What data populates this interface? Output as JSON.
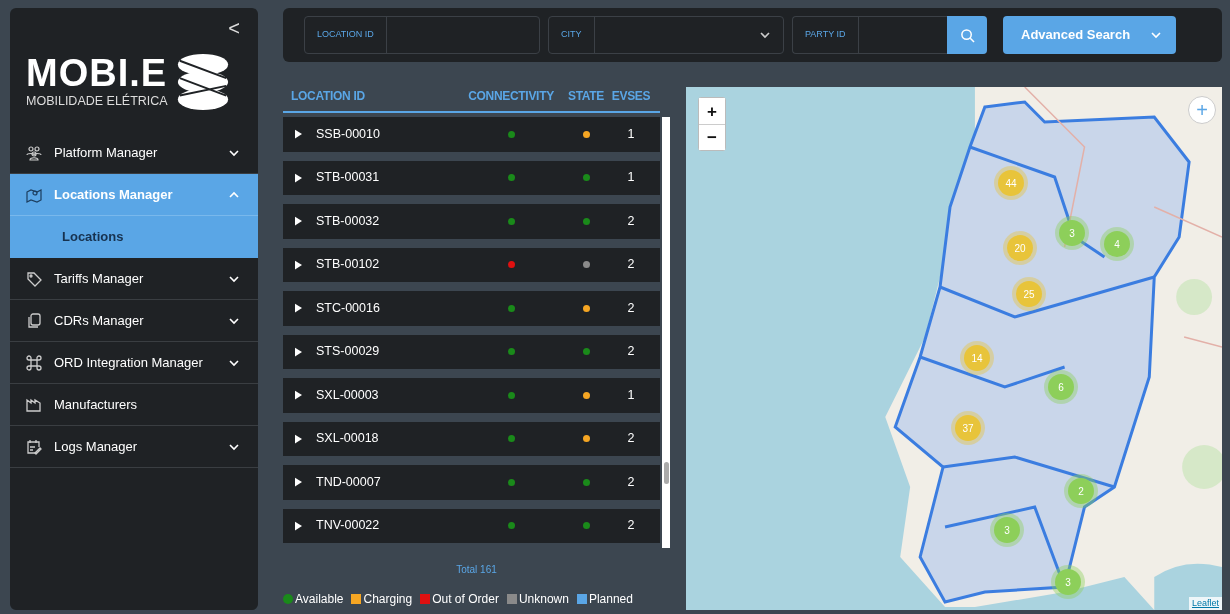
{
  "sidebar": {
    "collapse_glyph": "<",
    "logo": {
      "wordmark": "MOBI.E",
      "tagline": "MOBILIDADE ELÉTRICA"
    },
    "items": [
      {
        "label": "Platform Manager",
        "expanded": false,
        "selected": false
      },
      {
        "label": "Locations Manager",
        "expanded": true,
        "selected": true,
        "children": [
          {
            "label": "Locations",
            "selected": true
          }
        ]
      },
      {
        "label": "Tariffs Manager",
        "expanded": false,
        "selected": false
      },
      {
        "label": "CDRs Manager",
        "expanded": false,
        "selected": false
      },
      {
        "label": "ORD Integration Manager",
        "expanded": false,
        "selected": false
      },
      {
        "label": "Manufacturers",
        "selected": false
      },
      {
        "label": "Logs Manager",
        "expanded": false,
        "selected": false
      }
    ]
  },
  "search": {
    "fields": [
      {
        "label": "LOCATION ID",
        "kind": "text"
      },
      {
        "label": "CITY",
        "kind": "select"
      },
      {
        "label": "PARTY ID",
        "kind": "search"
      }
    ],
    "advanced_button": "Advanced Search"
  },
  "table": {
    "columns": [
      "LOCATION ID",
      "CONNECTIVITY",
      "STATE",
      "EVSES"
    ],
    "rows": [
      {
        "id": "SSB-00010",
        "connectivity": {
          "color": "#1a8a1a"
        },
        "state": {
          "color": "#f5a623"
        },
        "evses": "1"
      },
      {
        "id": "STB-00031",
        "connectivity": {
          "color": "#1a8a1a"
        },
        "state": {
          "color": "#1a8a1a"
        },
        "evses": "1"
      },
      {
        "id": "STB-00032",
        "connectivity": {
          "color": "#1a8a1a"
        },
        "state": {
          "color": "#1a8a1a"
        },
        "evses": "2"
      },
      {
        "id": "STB-00102",
        "connectivity": {
          "color": "#e01010"
        },
        "state": {
          "color": "#8a8a8a"
        },
        "evses": "2"
      },
      {
        "id": "STC-00016",
        "connectivity": {
          "color": "#1a8a1a"
        },
        "state": {
          "color": "#f5a623"
        },
        "evses": "2"
      },
      {
        "id": "STS-00029",
        "connectivity": {
          "color": "#1a8a1a"
        },
        "state": {
          "color": "#1a8a1a"
        },
        "evses": "2"
      },
      {
        "id": "SXL-00003",
        "connectivity": {
          "color": "#1a8a1a"
        },
        "state": {
          "color": "#f5a623"
        },
        "evses": "1"
      },
      {
        "id": "SXL-00018",
        "connectivity": {
          "color": "#1a8a1a"
        },
        "state": {
          "color": "#f5a623"
        },
        "evses": "2"
      },
      {
        "id": "TND-00007",
        "connectivity": {
          "color": "#1a8a1a"
        },
        "state": {
          "color": "#1a8a1a"
        },
        "evses": "2"
      },
      {
        "id": "TNV-00022",
        "connectivity": {
          "color": "#1a8a1a"
        },
        "state": {
          "color": "#1a8a1a"
        },
        "evses": "2"
      }
    ],
    "total": "Total 161"
  },
  "legend": [
    {
      "kind": "available",
      "label": "Available",
      "color": "#1a8a1a"
    },
    {
      "kind": "charging",
      "label": "Charging",
      "color": "#f5a623"
    },
    {
      "kind": "out_of_order",
      "label": "Out of Order",
      "color": "#e01010"
    },
    {
      "kind": "unknown",
      "label": "Unknown",
      "color": "#8a8a8a"
    },
    {
      "kind": "planned",
      "label": "Planned",
      "color": "#5aa6e6"
    }
  ],
  "map": {
    "zoom_in": "+",
    "zoom_out": "−",
    "corner_button": "+",
    "attribution": "Leaflet",
    "clusters": [
      {
        "count": "44",
        "color": "#e8c43a"
      },
      {
        "count": "3",
        "color": "#8dcf5a"
      },
      {
        "count": "4",
        "color": "#8dcf5a"
      },
      {
        "count": "20",
        "color": "#e8c43a"
      },
      {
        "count": "25",
        "color": "#e8c43a"
      },
      {
        "count": "14",
        "color": "#e8c43a"
      },
      {
        "count": "6",
        "color": "#8dcf5a"
      },
      {
        "count": "37",
        "color": "#e8c43a"
      },
      {
        "count": "2",
        "color": "#8dcf5a"
      },
      {
        "count": "3",
        "color": "#8dcf5a"
      },
      {
        "count": "3",
        "color": "#8dcf5a"
      }
    ]
  }
}
